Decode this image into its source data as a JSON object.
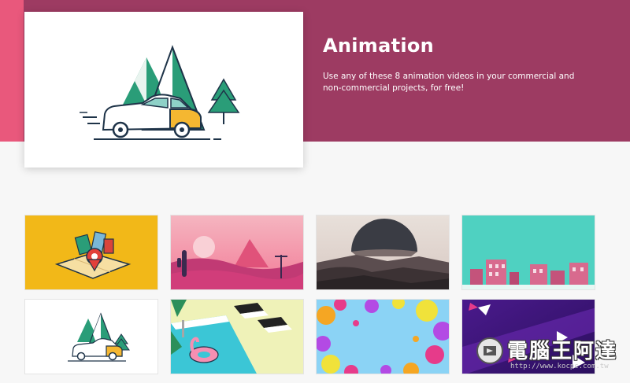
{
  "hero": {
    "title": "Animation",
    "description": "Use any of these 8 animation videos in your commercial and non-commercial projects, for free!"
  },
  "thumbnails": [
    {
      "subject": "travel-map"
    },
    {
      "subject": "pink-desert"
    },
    {
      "subject": "mountain-landscape"
    },
    {
      "subject": "town-street"
    },
    {
      "subject": "car-mountains"
    },
    {
      "subject": "pool-flamingo"
    },
    {
      "subject": "colorful-dots"
    },
    {
      "subject": "purple-triangles"
    }
  ],
  "watermark": {
    "text": "電腦王阿達",
    "url": "http://www.kocpc.com.tw"
  },
  "colors": {
    "band": "#9d3b62",
    "band_accent": "#e9587c",
    "page_bg": "#f7f7f7"
  }
}
